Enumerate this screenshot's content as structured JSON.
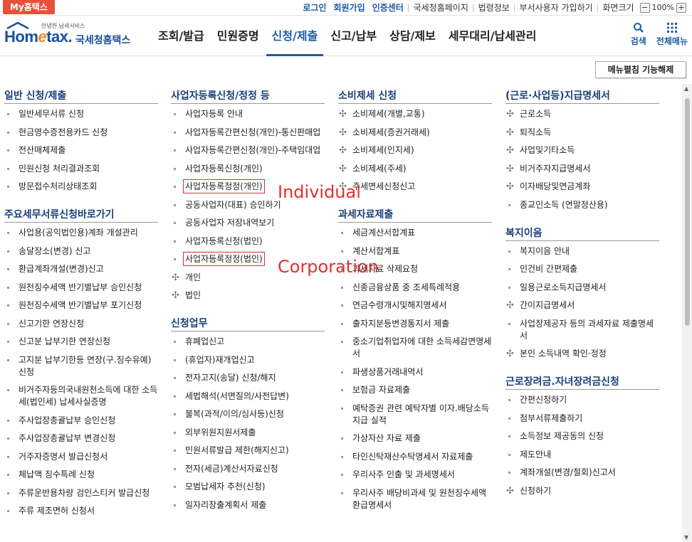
{
  "topbar": {
    "my_hometax": "My홈택스",
    "links": [
      "로그인",
      "회원가입",
      "인증센터"
    ],
    "gray_links": [
      "국세청홈페이지",
      "법령정보",
      "부서사용자 가입하기",
      "화면크기"
    ],
    "zoom_minus": "−",
    "zoom_value": "100%",
    "zoom_plus": "+"
  },
  "logo": {
    "tagline": "안녕한 납세서비스",
    "brand_pre": "Hom",
    "brand_e": "e",
    "brand_post": "tax.",
    "kr": "국세청홈택스"
  },
  "gnb": {
    "items": [
      "조회/발급",
      "민원증명",
      "신청/제출",
      "신고/납부",
      "상담/제보",
      "세무대리/납세관리"
    ],
    "active_index": 2
  },
  "tools": {
    "search": "검색",
    "all_menu": "전체메뉴"
  },
  "unfold_button": "메뉴펼침 기능해제",
  "col1": {
    "title1": "일반 신청/제출",
    "items1": [
      "일반세무서류 신청",
      "현금영수증전용카드 신청",
      "전산매체제출",
      "민원신청 처리결과조회",
      "방문접수처리상태조회"
    ],
    "title2": "주요세무서류신청바로가기",
    "items2": [
      "사업용(공익법인용)계좌 개설관리",
      "송달장소(변경) 신고",
      "환급계좌개설(변경)신고",
      "원천징수세액 반기별납부 승인신청",
      "원천징수세액 반기별납부 포기신청",
      "신고기한 연장신청",
      "신고분 납부기한 연장신청",
      "고지분 납부기한등 연장(구.징수유예) 신청",
      "비거주자등의국내원천소득에 대한 소득세(법인세) 납세사실증명",
      "주사업장총괄납부 승인신청",
      "주사업장총괄납부 변경신청",
      "거주자증명서 발급신청서",
      "체납액 징수특례 신청",
      "주류운반용차량 검인스티커 발급신청",
      "주류 제조면허 신청서"
    ]
  },
  "col2": {
    "title1": "사업자등록신청/정정 등",
    "items1": [
      "사업자등록 안내",
      "사업자등록간편신청(개인)-통신판매업",
      "사업자등록간편신청(개인)-주택임대업",
      "사업자등록신청(개인)",
      "사업자등록정정(개인)",
      "공동사업자(대표) 승인하기",
      "공동사업자 저장내역보기",
      "사업자등록신청(법인)",
      "사업자등록정정(법인)",
      "개인",
      "법인"
    ],
    "title2": "신청업무",
    "items2": [
      "휴폐업신고",
      "(휴업자)재개업신고",
      "전자고지(송달) 신청/해지",
      "세법해석(서면질의/사전답변)",
      "불복(과적/이의/심사등)신청",
      "외부위원지원서제출",
      "민원서류발급 제한(해지신고)",
      "전자(세금)계산서자료신청",
      "모범납세자 추천(신청)",
      "일자리창출계획서 제출"
    ]
  },
  "col3": {
    "title1": "소비제세 신청",
    "items1": [
      "소비제세(개별,교통)",
      "소비제세(증권거래세)",
      "소비제세(인지세)",
      "소비제세(주세)",
      "주세면세신청신고"
    ],
    "title2": "과세자료제출",
    "items2": [
      "세금계산서합계표",
      "계산서합계표",
      "과세자료 삭제요청",
      "신종금융상품 중 조세특례적용",
      "연금수령개시및해지명세서",
      "출자지분등변경통지서 제출",
      "중소기업취업자에 대한 소득세감면명세서",
      "파생상품거래내역서",
      "보험금 자료제출",
      "예탁증권 관련 예탁자별 이자.배당소득지급 실적",
      "가상자산 자료 제출",
      "타인신탁재산수탁명세서 자료제출",
      "우리사주 인출 및 과세명세서",
      "우리사주 배당비과세 및 원천징수세액 환급명세서"
    ]
  },
  "col4": {
    "title1": "(근로·사업등)지급명세서",
    "items1": [
      "근로소득",
      "퇴직소득",
      "사업및기타소득",
      "비거주자지급명세서",
      "이자배당및연금계좌",
      "종교인소득 (연말정산용)"
    ],
    "title2": "복지이음",
    "items2": [
      "복지이음 안내",
      "인건비 간편제출",
      "일용근로소득지급명세서",
      "간이지급명세서",
      "사업장제공자 등의 과세자료 제출명세서",
      "본인 소득내역 확인·정정"
    ],
    "title3": "근로장려금.자녀장려금신청",
    "items3": [
      "간편신청하기",
      "첨부서류제출하기",
      "소득정보 제공동의 신청",
      "제도안내",
      "계좌개설(변경/철회)신고서",
      "신청하기"
    ]
  },
  "annotations": {
    "individual": "Individual",
    "corporation": "Corporation"
  },
  "scrollbar": {
    "up": "▲",
    "down": "▼"
  }
}
